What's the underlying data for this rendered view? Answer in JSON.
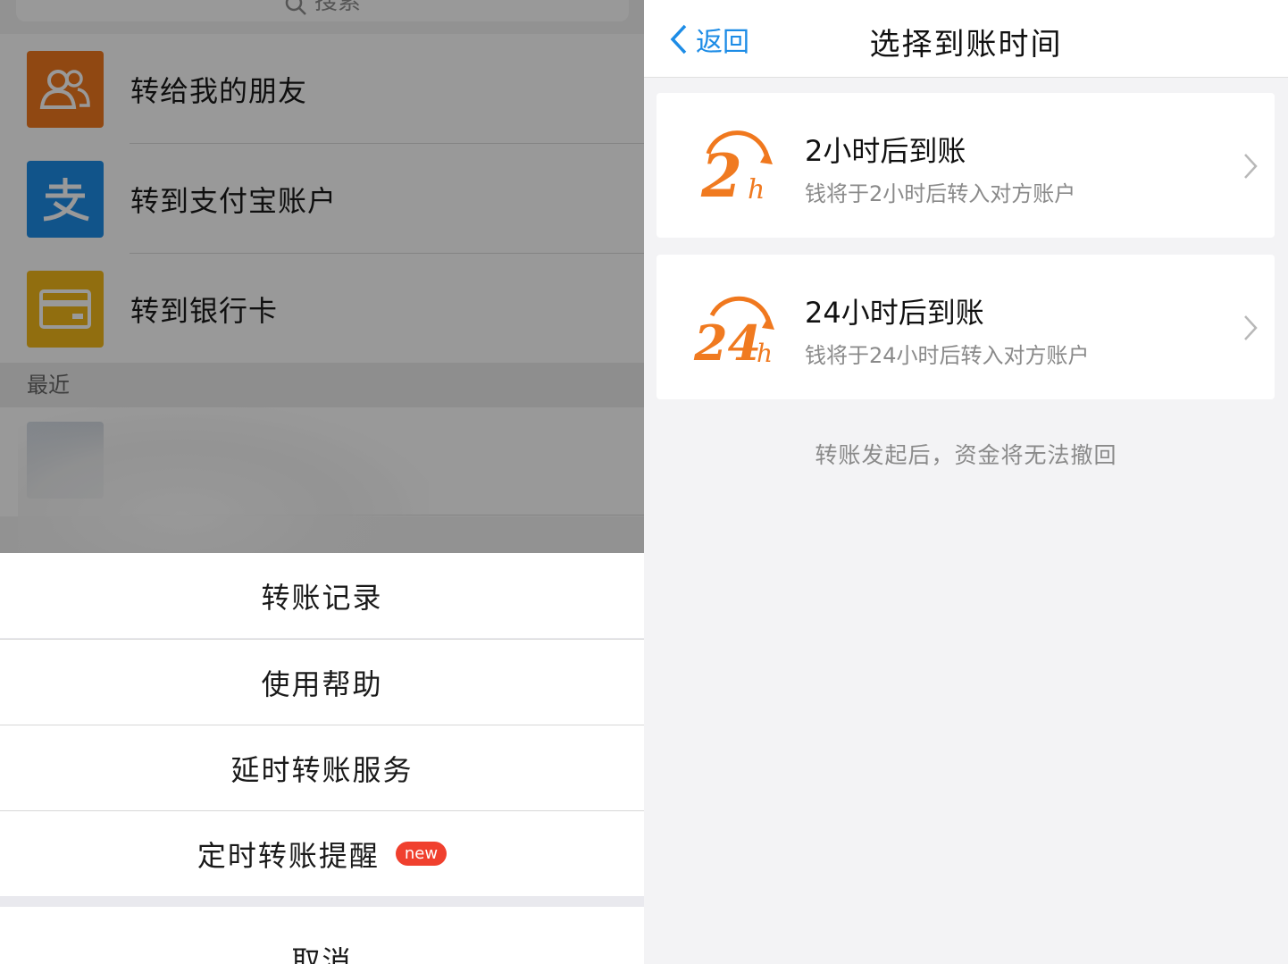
{
  "left": {
    "search": {
      "placeholder": "搜索"
    },
    "menu": [
      {
        "label": "转给我的朋友",
        "icon": "friends-icon"
      },
      {
        "label": "转到支付宝账户",
        "icon": "alipay-icon"
      },
      {
        "label": "转到银行卡",
        "icon": "bank-card-icon"
      }
    ],
    "recent_header": "最近",
    "action_sheet": {
      "items": [
        "转账记录",
        "使用帮助",
        "延时转账服务",
        "定时转账提醒"
      ],
      "new_badge": "new",
      "cancel": "取消"
    }
  },
  "right": {
    "nav": {
      "back": "返回",
      "title": "选择到账时间"
    },
    "options": [
      {
        "title": "2小时后到账",
        "desc": "钱将于2小时后转入对方账户",
        "icon": "2h-icon"
      },
      {
        "title": "24小时后到账",
        "desc": "钱将于24小时后转入对方账户",
        "icon": "24h-icon"
      }
    ],
    "note": "转账发起后，资金将无法撤回"
  },
  "colors": {
    "accent_blue": "#1d8ce6",
    "orange": "#f0781e",
    "yellow": "#f2b81a",
    "badge_red": "#f0402e"
  }
}
